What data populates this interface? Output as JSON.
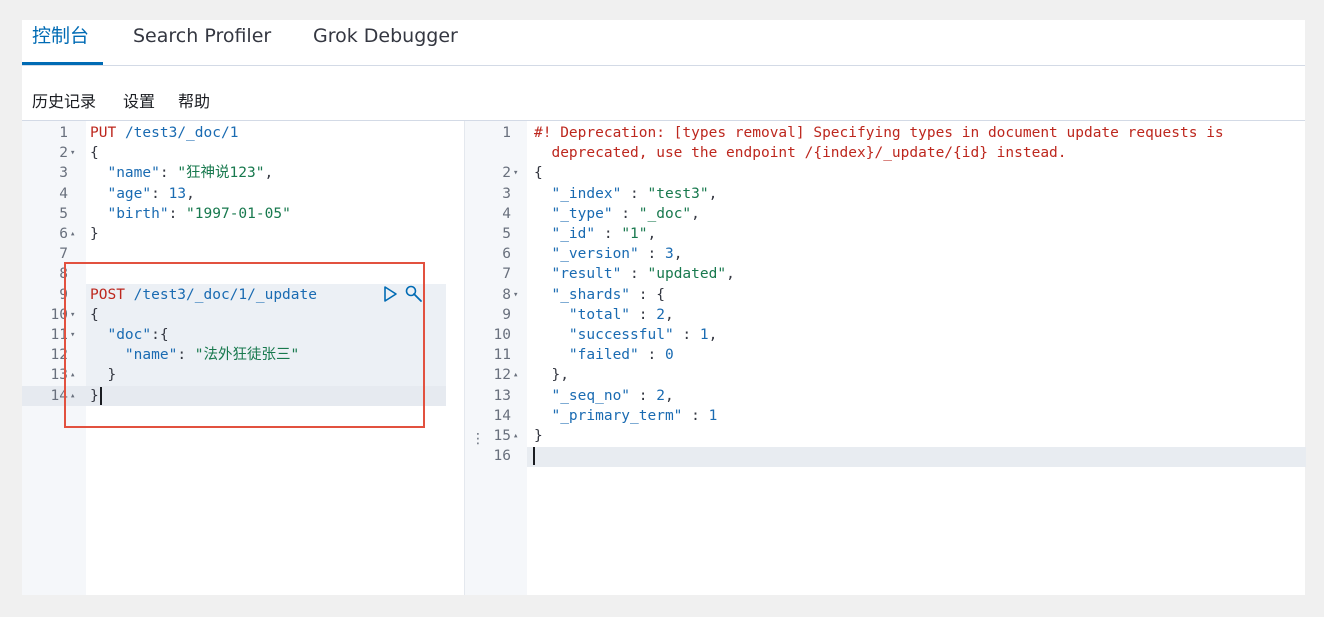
{
  "tabs": [
    {
      "label": "控制台",
      "active": true
    },
    {
      "label": "Search Profiler",
      "active": false
    },
    {
      "label": "Grok Debugger",
      "active": false
    }
  ],
  "menu": [
    "历史记录",
    "设置",
    "帮助"
  ],
  "request_editor": {
    "lines": [
      {
        "n": "1",
        "fold": "",
        "code": "PUT /test3/_doc/1"
      },
      {
        "n": "2",
        "fold": "▾",
        "code": "{"
      },
      {
        "n": "3",
        "fold": "",
        "code": "  \"name\": \"狂神说123\","
      },
      {
        "n": "4",
        "fold": "",
        "code": "  \"age\": 13,"
      },
      {
        "n": "5",
        "fold": "",
        "code": "  \"birth\": \"1997-01-05\""
      },
      {
        "n": "6",
        "fold": "▴",
        "code": "}"
      },
      {
        "n": "7",
        "fold": "",
        "code": ""
      },
      {
        "n": "8",
        "fold": "",
        "code": ""
      },
      {
        "n": "9",
        "fold": "",
        "code": "POST /test3/_doc/1/_update"
      },
      {
        "n": "10",
        "fold": "▾",
        "code": "{"
      },
      {
        "n": "11",
        "fold": "▾",
        "code": "  \"doc\":{"
      },
      {
        "n": "12",
        "fold": "",
        "code": "    \"name\": \"法外狂徒张三\""
      },
      {
        "n": "13",
        "fold": "▴",
        "code": "  }"
      },
      {
        "n": "14",
        "fold": "▴",
        "code": "}"
      }
    ],
    "send_icon": "play-icon",
    "settings_icon": "wrench-icon"
  },
  "response_editor": {
    "lines": [
      {
        "n": "1",
        "fold": "",
        "code": "#! Deprecation: [types removal] Specifying types in document update requests is"
      },
      {
        "n": "",
        "fold": "",
        "code": "  deprecated, use the endpoint /{index}/_update/{id} instead."
      },
      {
        "n": "2",
        "fold": "▾",
        "code": "{"
      },
      {
        "n": "3",
        "fold": "",
        "code": "  \"_index\" : \"test3\","
      },
      {
        "n": "4",
        "fold": "",
        "code": "  \"_type\" : \"_doc\","
      },
      {
        "n": "5",
        "fold": "",
        "code": "  \"_id\" : \"1\","
      },
      {
        "n": "6",
        "fold": "",
        "code": "  \"_version\" : 3,"
      },
      {
        "n": "7",
        "fold": "",
        "code": "  \"result\" : \"updated\","
      },
      {
        "n": "8",
        "fold": "▾",
        "code": "  \"_shards\" : {"
      },
      {
        "n": "9",
        "fold": "",
        "code": "    \"total\" : 2,"
      },
      {
        "n": "10",
        "fold": "",
        "code": "    \"successful\" : 1,"
      },
      {
        "n": "11",
        "fold": "",
        "code": "    \"failed\" : 0"
      },
      {
        "n": "12",
        "fold": "▴",
        "code": "  },"
      },
      {
        "n": "13",
        "fold": "",
        "code": "  \"_seq_no\" : 2,"
      },
      {
        "n": "14",
        "fold": "",
        "code": "  \"_primary_term\" : 1"
      },
      {
        "n": "15",
        "fold": "▴",
        "code": "}"
      },
      {
        "n": "16",
        "fold": "",
        "code": ""
      }
    ]
  },
  "splitter_icon": "drag-handle-icon",
  "colors": {
    "accent": "#006bb4",
    "method": "#bd271e",
    "string": "#18794e",
    "key": "#1a6bb2",
    "highlight_box": "#e2513f"
  }
}
